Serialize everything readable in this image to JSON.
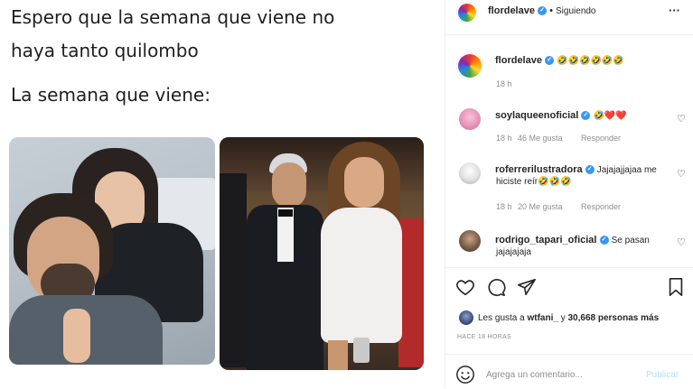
{
  "meme": {
    "line1": "Espero que la semana que viene no",
    "line2": "haya tanto quilombo",
    "line3": "La semana que viene:"
  },
  "header": {
    "username": "flordelave",
    "dot": "•",
    "follow_state": "Siguiendo",
    "more": "···"
  },
  "caption": {
    "username": "flordelave",
    "text": "🤣🤣🤣🤣🤣🤣",
    "time": "18 h"
  },
  "comments": [
    {
      "username": "soylaqueenoficial",
      "text": "🤣❤️❤️",
      "time": "18 h",
      "likes": "46 Me gusta",
      "reply": "Responder"
    },
    {
      "username": "roferrerilustradora",
      "text": "Jajajajjajaa me",
      "text2": "hiciste reír🤣🤣🤣",
      "time": "18 h",
      "likes": "20 Me gusta",
      "reply": "Responder"
    },
    {
      "username": "rodrigo_tapari_oficial",
      "text": "Se pasan",
      "text2": "jajajajaja"
    }
  ],
  "likes": {
    "prefix": "Les gusta a ",
    "user": "wtfani_",
    "middle": " y ",
    "count": "30,668",
    "suffix": " personas más"
  },
  "timestamp": "HACE 18 HORAS",
  "composer": {
    "placeholder": "Agrega un comentario...",
    "publish": "Publicar"
  },
  "colors": {
    "verified": "#3897f0",
    "publish_disabled": "#b2dffc"
  },
  "icons": [
    "heart-icon",
    "comment-icon",
    "share-icon",
    "bookmark-icon",
    "emoji-icon",
    "more-icon"
  ]
}
